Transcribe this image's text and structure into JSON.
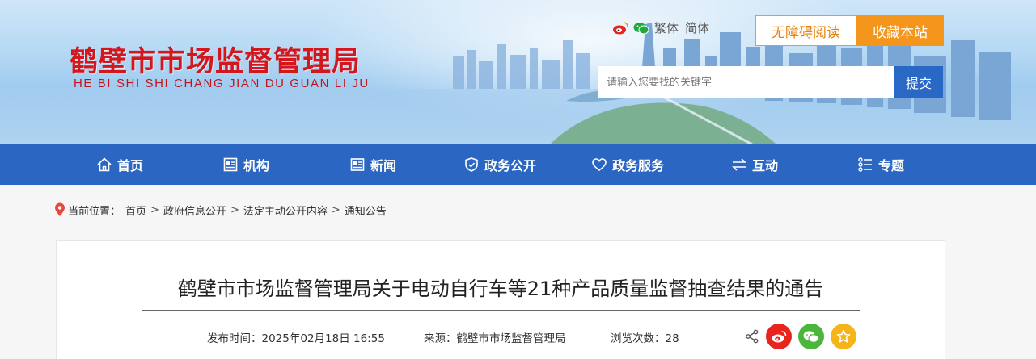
{
  "site": {
    "logo_cn": "鹤壁市市场监督管理局",
    "logo_pinyin": "HE BI SHI SHI CHANG JIAN DU GUAN LI JU"
  },
  "top_tools": {
    "traditional": "繁体",
    "simplified": "简体",
    "accessibility_label": "无障碍阅读",
    "favorite_label": "收藏本站"
  },
  "search": {
    "placeholder": "请输入您要找的关键字",
    "submit_label": "提交"
  },
  "nav": {
    "items": [
      {
        "label": "首页",
        "icon": "home-icon"
      },
      {
        "label": "机构",
        "icon": "org-icon"
      },
      {
        "label": "新闻",
        "icon": "news-icon"
      },
      {
        "label": "政务公开",
        "icon": "shield-icon"
      },
      {
        "label": "政务服务",
        "icon": "heart-icon"
      },
      {
        "label": "互动",
        "icon": "exchange-icon"
      },
      {
        "label": "专题",
        "icon": "list-icon"
      }
    ]
  },
  "breadcrumb": {
    "prefix": "当前位置：",
    "items": [
      "首页",
      "政府信息公开",
      "法定主动公开内容",
      "通知公告"
    ],
    "separator": ">"
  },
  "article": {
    "title": "鹤壁市市场监督管理局关于电动自行车等21种产品质量监督抽查结果的通告",
    "publish_time": "发布时间：2025年02月18日 16:55",
    "source": "来源：鹤壁市市场监督管理局",
    "views": "浏览次数：28"
  },
  "colors": {
    "brand_red": "#d4161d",
    "nav_blue": "#2c66c3",
    "accent_orange": "#f5961c",
    "weibo_red": "#e8251c",
    "wechat_green": "#4cb53c",
    "fav_yellow": "#f5b51a"
  }
}
